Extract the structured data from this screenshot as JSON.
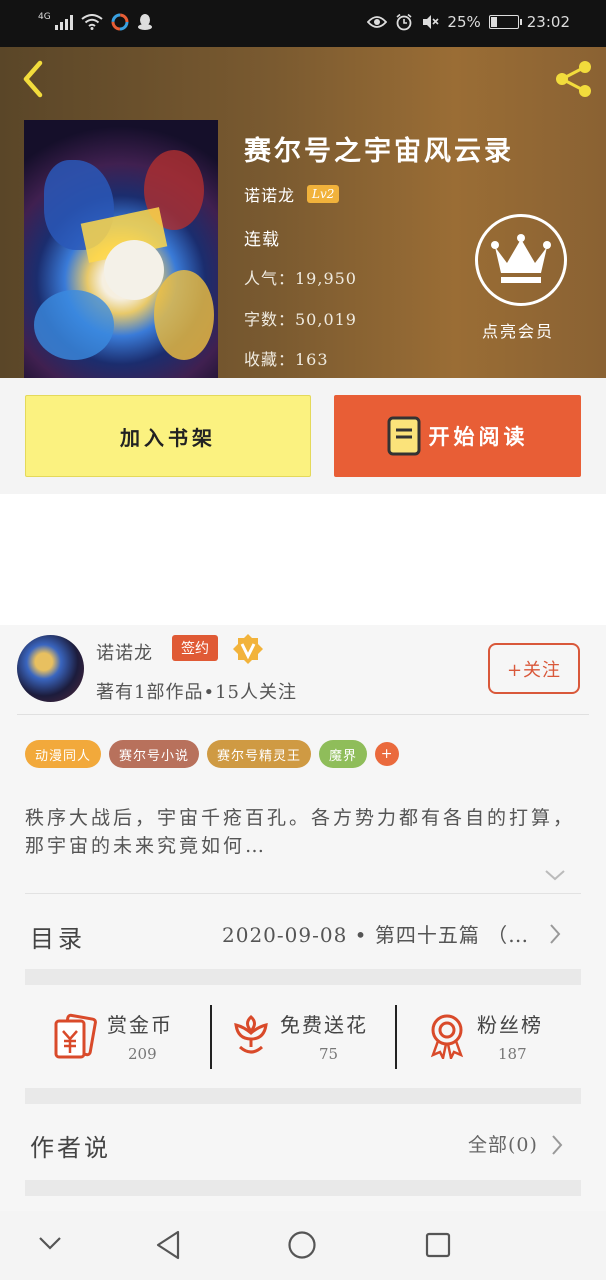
{
  "status_bar": {
    "network": "4G",
    "battery_percent": "25%",
    "battery_level": 0.25,
    "time": "23:02",
    "icons": [
      "signal-icon",
      "wifi-icon",
      "app-icon",
      "qq-icon",
      "eye-icon",
      "alarm-icon",
      "mute-icon",
      "battery-icon"
    ]
  },
  "book": {
    "title": "赛尔号之宇宙风云录",
    "author": "诺诺龙",
    "level": "Lv2",
    "status": "连载",
    "popularity": "人气：19,950",
    "words": "字数：50,019",
    "favorites": "收藏：163"
  },
  "vip": {
    "label": "点亮会员"
  },
  "actions": {
    "add_shelf": "加入书架",
    "start_read": "开始阅读"
  },
  "author": {
    "name": "诺诺龙",
    "badge": "签约",
    "info": "著有1部作品•15人关注",
    "follow": "+关注"
  },
  "tags": [
    {
      "label": "动漫同人",
      "color": "#f2a93b"
    },
    {
      "label": "赛尔号小说",
      "color": "#b8715c"
    },
    {
      "label": "赛尔号精灵王",
      "color": "#cf9a43"
    },
    {
      "label": "魔界",
      "color": "#8fbd5a"
    }
  ],
  "tags_more": "+",
  "tags_more_color": "#ea6a3d",
  "description": "秩序大战后，宇宙千疮百孔。各方势力都有各自的打算，那宇宙的未来究竟如何…",
  "toc": {
    "label": "目录",
    "latest": "2020-09-08 • 第四十五篇 （…"
  },
  "stats": [
    {
      "label": "赏金币",
      "value": "209",
      "icon": "red-envelope-icon"
    },
    {
      "label": "免费送花",
      "value": "75",
      "icon": "flower-icon"
    },
    {
      "label": "粉丝榜",
      "value": "187",
      "icon": "medal-icon"
    }
  ],
  "author_says": {
    "label": "作者说",
    "all": "全部(0)"
  },
  "nav": {
    "icons": [
      "collapse-icon",
      "back-icon",
      "home-icon",
      "recent-apps-icon"
    ]
  },
  "colors": {
    "accent": "#e85e36",
    "shelf_button": "#fbf280",
    "header_brown": "#7a5a30"
  }
}
